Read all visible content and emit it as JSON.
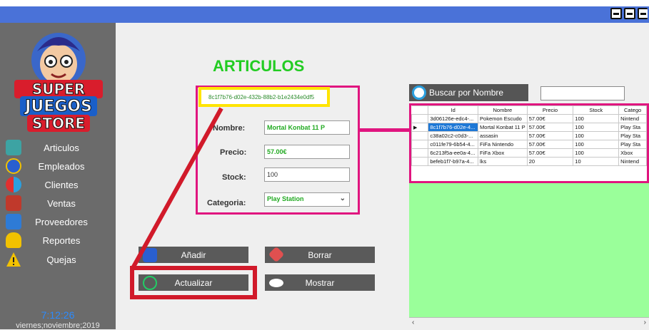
{
  "window": {
    "controls": [
      "minimize-icon",
      "maximize-icon",
      "close-icon"
    ]
  },
  "logo": {
    "line1": "SUPER",
    "line2": "JUEGOS",
    "line3": "STORE"
  },
  "sidebar": {
    "items": [
      {
        "label": "Articulos",
        "icon": "articles-icon"
      },
      {
        "label": "Empleados",
        "icon": "employees-icon"
      },
      {
        "label": "Clientes",
        "icon": "clients-icon"
      },
      {
        "label": "Ventas",
        "icon": "cart-icon"
      },
      {
        "label": "Proveedores",
        "icon": "suppliers-icon"
      },
      {
        "label": "Reportes",
        "icon": "bell-icon"
      },
      {
        "label": "Quejas",
        "icon": "warning-icon"
      }
    ],
    "time": "7:12:26",
    "date": "viernes;noviembre;2019"
  },
  "main": {
    "title": "ARTICULOS",
    "id_value": "8c1f7b76-d02e-432b-88b2-b1e2434e0df5",
    "form": {
      "nombre_label": "Nombre:",
      "nombre_value": "Mortal Konbat 11 P",
      "precio_label": "Precio:",
      "precio_value": "57.00€",
      "stock_label": "Stock:",
      "stock_value": "100",
      "categoria_label": "Categoria:",
      "categoria_value": "Play Station"
    },
    "buttons": {
      "add": "Añadir",
      "delete": "Borrar",
      "update": "Actualizar",
      "show": "Mostrar"
    }
  },
  "search": {
    "label": "Buscar por Nombre",
    "value": ""
  },
  "table": {
    "columns": [
      "Id",
      "Nombre",
      "Precio",
      "Stock",
      "Catego"
    ],
    "rows": [
      [
        "3d06126e-edc4-...",
        "Pokemon Escudo",
        "57.00€",
        "100",
        "Nintend"
      ],
      [
        "8c1f7b76-d02e-4...",
        "Mortal Konbat 11 P",
        "57.00€",
        "100",
        "Play Sta"
      ],
      [
        "c38a02c2-c0d3-...",
        "assasin",
        "57.00€",
        "100",
        "Play Sta"
      ],
      [
        "c011fe79-6b54-4...",
        "FiFa Nintendo",
        "57.00€",
        "100",
        "Play Sta"
      ],
      [
        "6c213f5a-ee0a-4...",
        "FiFa Xbox",
        "57.00€",
        "100",
        "Xbox"
      ],
      [
        "befeb1f7-b97a-4...",
        "lks",
        "20",
        "10",
        "Nintend"
      ]
    ],
    "selected_row": 1
  },
  "colors": {
    "accent_green": "#22cc22",
    "highlight_pink": "#e0157f",
    "highlight_yellow": "#ffe400",
    "annotation_red": "#d11a2a"
  }
}
